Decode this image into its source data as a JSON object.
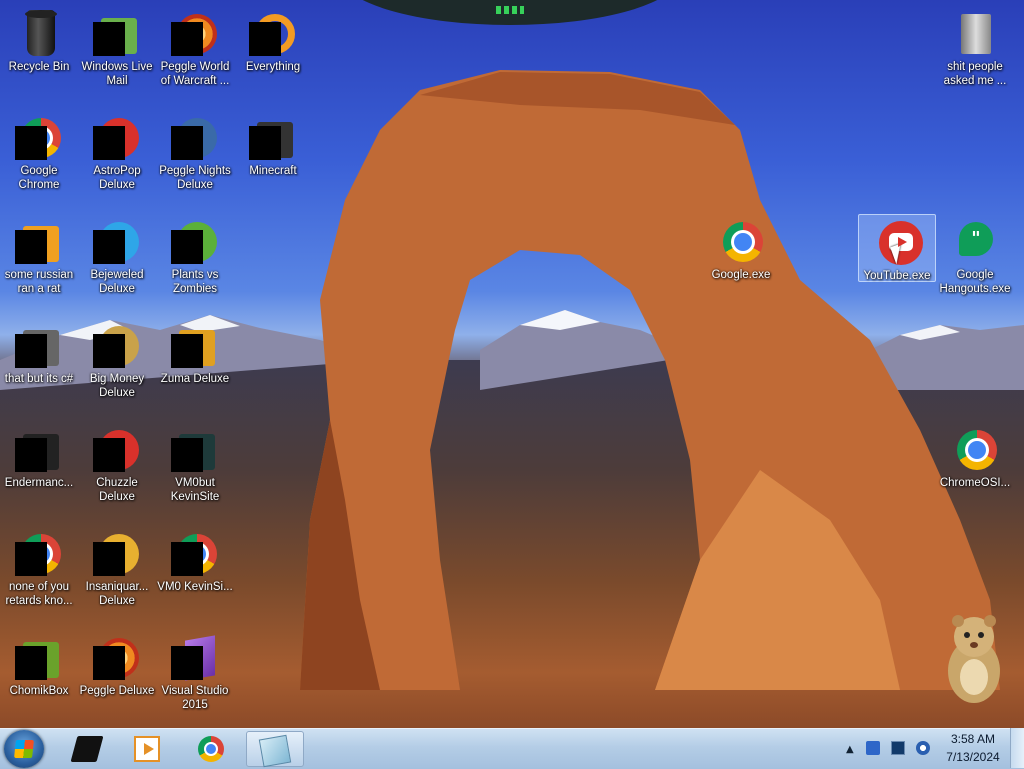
{
  "desktop": {
    "icons": [
      {
        "label": "Recycle Bin"
      },
      {
        "label": "Windows Live Mail"
      },
      {
        "label": "Peggle World of Warcraft ..."
      },
      {
        "label": "Everything"
      },
      {
        "label": "Google Chrome"
      },
      {
        "label": "AstroPop Deluxe"
      },
      {
        "label": "Peggle Nights Deluxe"
      },
      {
        "label": "Minecraft"
      },
      {
        "label": "some russian ran a rat"
      },
      {
        "label": "Bejeweled Deluxe"
      },
      {
        "label": "Plants vs Zombies"
      },
      {
        "label": "that but its c#"
      },
      {
        "label": "Big Money Deluxe"
      },
      {
        "label": "Zuma Deluxe"
      },
      {
        "label": "Endermanc..."
      },
      {
        "label": "Chuzzle Deluxe"
      },
      {
        "label": "VM0but KevinSite"
      },
      {
        "label": "none of you retards kno..."
      },
      {
        "label": "Insaniquar... Deluxe"
      },
      {
        "label": "VM0 KevinSi..."
      },
      {
        "label": "ChomikBox"
      },
      {
        "label": "Peggle Deluxe"
      },
      {
        "label": "Visual Studio 2015"
      },
      {
        "label": "shit people asked me ..."
      },
      {
        "label": "Google.exe"
      },
      {
        "label": "YouTube.exe"
      },
      {
        "label": "Google Hangouts.exe"
      },
      {
        "label": "ChromeOSI..."
      }
    ]
  },
  "taskbar": {
    "clock": {
      "time": "3:58 AM",
      "date": "7/13/2024"
    },
    "tray_expand": "▲"
  },
  "colors": {
    "taskbar": "#b4cde6",
    "selection": "#b4d2ff",
    "desktop_text": "#ffffff"
  }
}
